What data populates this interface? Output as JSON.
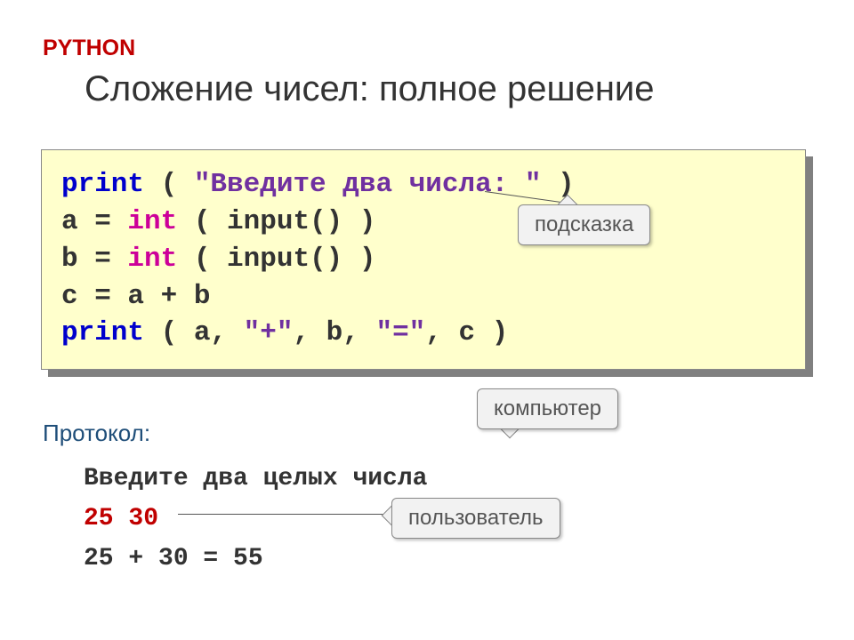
{
  "header": {
    "language_label": "PYTHON",
    "title": "Сложение чисел: полное решение"
  },
  "code": {
    "line1": {
      "kw": "print",
      "open": " ( ",
      "str": "\"Введите два числа: \"",
      "close": " )"
    },
    "line2": {
      "lhs": "a = ",
      "fn": "int",
      "open": " ( ",
      "inner": "input()",
      "close": " )"
    },
    "line3": {
      "lhs": "b = ",
      "fn": "int",
      "open": " ( ",
      "inner": "input()",
      "close": " )"
    },
    "line4": {
      "text": "c = a + b"
    },
    "line5": {
      "kw": "print",
      "open": " ( ",
      "args_prefix": "a, ",
      "str_plus": "\"+\"",
      "args_mid": ", b, ",
      "str_eq": "\"=\"",
      "args_suffix": ", c )"
    }
  },
  "callouts": {
    "hint": "подсказка",
    "computer": "компьютер",
    "user": "пользователь"
  },
  "protocol": {
    "label": "Протокол:",
    "line1": "Введите два целых числа",
    "line2": "25 30",
    "line3": "25 + 30 = 55"
  }
}
